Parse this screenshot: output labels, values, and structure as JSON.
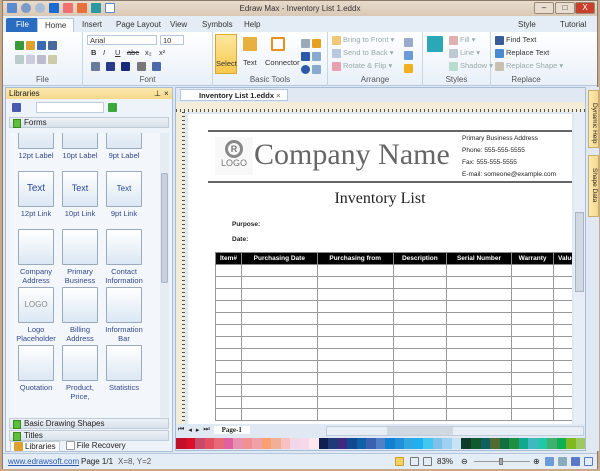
{
  "window": {
    "title": "Edraw Max - Inventory List 1.eddx",
    "minimize": "–",
    "maximize": "□",
    "close": "X"
  },
  "tabs": [
    "File",
    "Home",
    "Insert",
    "Page Layout",
    "View",
    "Symbols",
    "Help"
  ],
  "tabs_right": {
    "style": "Style",
    "tutorial": "Tutorial"
  },
  "ribbon": {
    "file_label": "File",
    "font": {
      "name": "Arial",
      "size": "10",
      "label": "Font",
      "bold": "B",
      "italic": "I",
      "underline": "U",
      "strike": "abc",
      "sub": "x₂",
      "sup": "x²"
    },
    "basic_tools": {
      "select": "Select",
      "text": "Text",
      "connector": "Connector",
      "label": "Basic Tools"
    },
    "arrange": {
      "bring_front": "Bring to Front",
      "send_back": "Send to Back",
      "rotate": "Rotate & Flip",
      "label": "Arrange"
    },
    "styles": {
      "fill": "Fill",
      "line": "Line",
      "shadow": "Shadow",
      "label": "Styles"
    },
    "replace": {
      "find": "Find Text",
      "replace_text": "Replace Text",
      "replace_shape": "Replace Shape",
      "label": "Replace"
    }
  },
  "library": {
    "title": "Libraries",
    "section": "Forms",
    "shapes": [
      {
        "label": "12pt Label"
      },
      {
        "label": "10pt Label"
      },
      {
        "label": "9pt Label"
      },
      {
        "label": "12pt Link",
        "preview": "Text"
      },
      {
        "label": "10pt Link",
        "preview": "Text"
      },
      {
        "label": "9pt Link",
        "preview": "Text"
      },
      {
        "label": "Company Address"
      },
      {
        "label": "Primary Business"
      },
      {
        "label": "Contact Information"
      },
      {
        "label": "Logo Placeholder",
        "preview": "LOGO"
      },
      {
        "label": "Billing Address"
      },
      {
        "label": "Information Bar"
      },
      {
        "label": "Quotation"
      },
      {
        "label": "Product, Price,"
      },
      {
        "label": "Statistics"
      }
    ],
    "collapsed": [
      "Basic Drawing Shapes",
      "Titles"
    ],
    "bottom_tabs": [
      "Libraries",
      "File Recovery"
    ]
  },
  "document": {
    "tab": "Inventory List 1.eddx",
    "page_tab": "Page-1",
    "logo": "LOGO",
    "company": "Company Name",
    "contact": [
      "Primary Business Address",
      "Phone: 555-555-5555",
      "Fax: 555-555-5555",
      "E-mail: someone@example.com"
    ],
    "title": "Inventory List",
    "purpose": "Purpose:",
    "date": "Date:",
    "columns": [
      "Item#",
      "Purchasing Date",
      "Purchasing from",
      "Description",
      "Serial Number",
      "Warranty",
      "Value"
    ]
  },
  "right_panel": [
    "Dynamic Help",
    "Shape Data"
  ],
  "palette": [
    "#c0102a",
    "#d8102a",
    "#c84a6a",
    "#e05060",
    "#e86a7a",
    "#e060a0",
    "#e890b0",
    "#f09090",
    "#f0a0a8",
    "#f8a070",
    "#f0b098",
    "#f8c0c0",
    "#f0d8e8",
    "#f8d8e8",
    "#fde8ee",
    "#102050",
    "#203a78",
    "#402a80",
    "#104a90",
    "#1060a8",
    "#3a60b0",
    "#5080c8",
    "#1080d0",
    "#2090d8",
    "#30a8e0",
    "#20b0f0",
    "#40c8f0",
    "#80c0e8",
    "#a0d0f0",
    "#c8e4f4",
    "#103a2a",
    "#105a30",
    "#106060",
    "#506a30",
    "#107040",
    "#209040",
    "#10a890",
    "#40b8c0",
    "#20c8a8",
    "#40b070",
    "#10b050",
    "#80b820",
    "#a0c860"
  ],
  "status": {
    "link": "www.edrawsoft.com",
    "page": "Page 1/1",
    "coords": "X=8, Y=2",
    "zoom": "83%",
    "zoom_level": 0.45
  }
}
